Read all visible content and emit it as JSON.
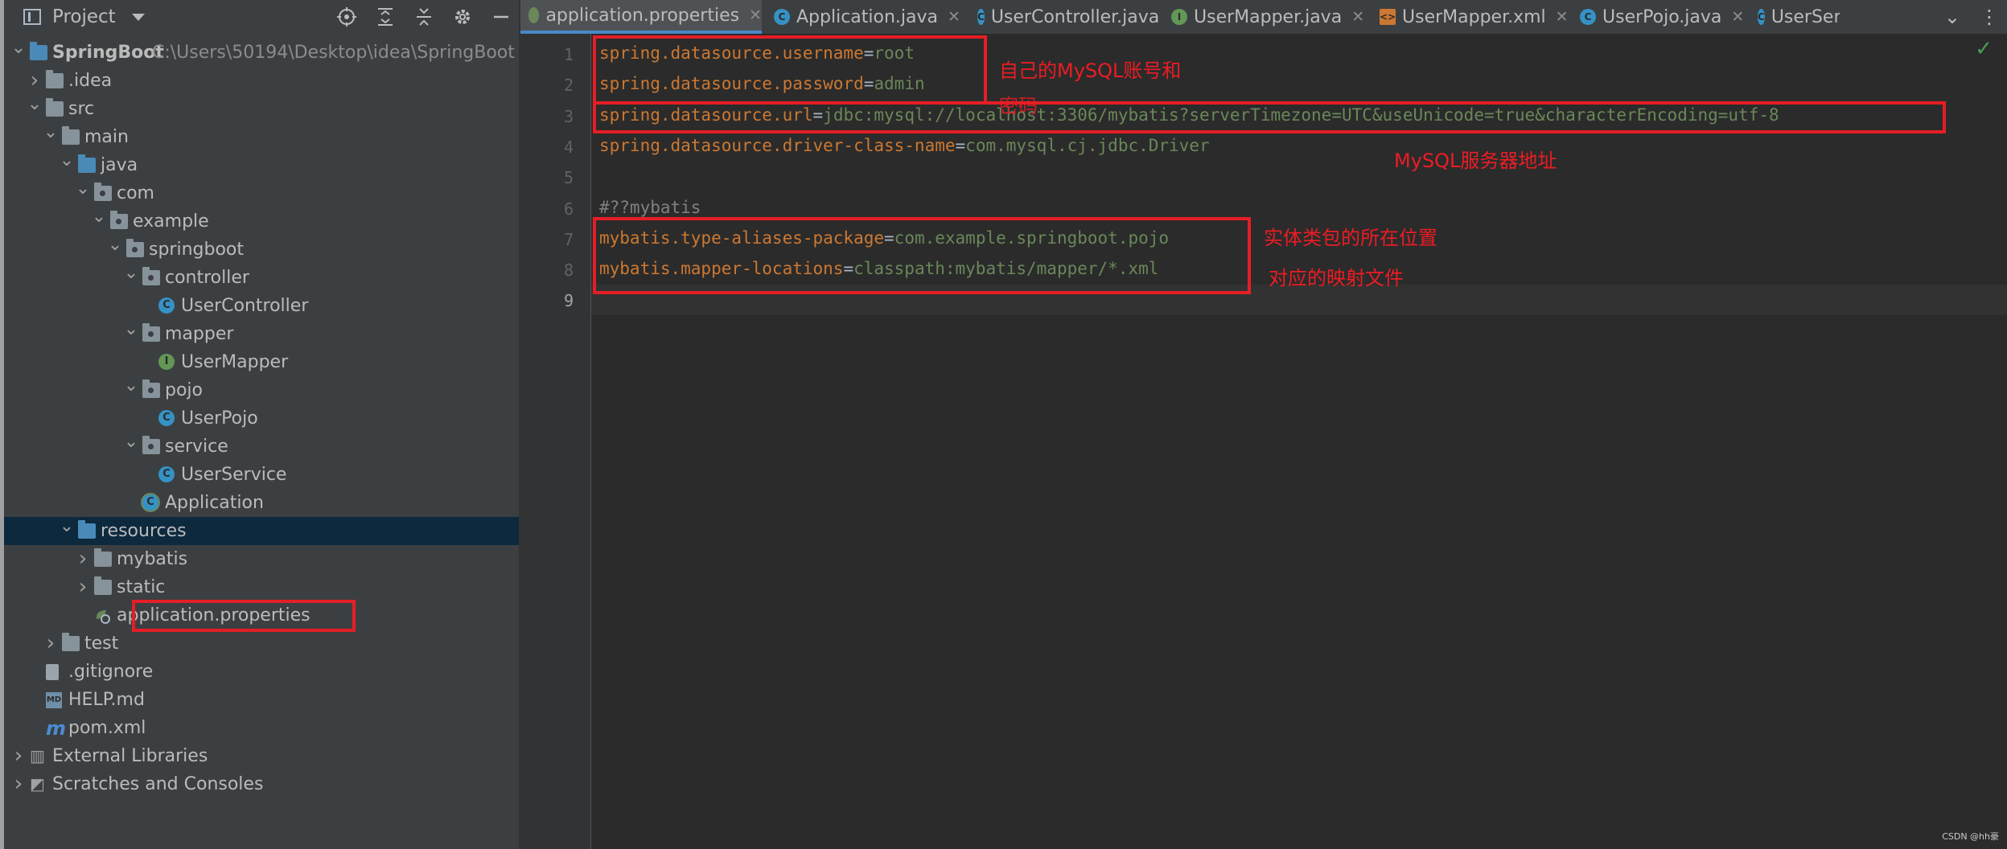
{
  "project_panel": {
    "title": "Project",
    "tree": [
      {
        "label": "SpringBoot",
        "hint": "C:\\Users\\50194\\Desktop\\idea\\SpringBoot",
        "depth": 0,
        "arrow": "down",
        "icon": "module-folder-icon",
        "bold": true
      },
      {
        "label": ".idea",
        "depth": 1,
        "arrow": "right",
        "icon": "folder-icon"
      },
      {
        "label": "src",
        "depth": 1,
        "arrow": "down",
        "icon": "folder-icon"
      },
      {
        "label": "main",
        "depth": 2,
        "arrow": "down",
        "icon": "folder-icon"
      },
      {
        "label": "java",
        "depth": 3,
        "arrow": "down",
        "icon": "source-folder-icon"
      },
      {
        "label": "com",
        "depth": 4,
        "arrow": "down",
        "icon": "package-icon"
      },
      {
        "label": "example",
        "depth": 5,
        "arrow": "down",
        "icon": "package-icon"
      },
      {
        "label": "springboot",
        "depth": 6,
        "arrow": "down",
        "icon": "package-icon"
      },
      {
        "label": "controller",
        "depth": 7,
        "arrow": "down",
        "icon": "package-icon"
      },
      {
        "label": "UserController",
        "depth": 8,
        "arrow": "",
        "icon": "class-icon"
      },
      {
        "label": "mapper",
        "depth": 7,
        "arrow": "down",
        "icon": "package-icon"
      },
      {
        "label": "UserMapper",
        "depth": 8,
        "arrow": "",
        "icon": "interface-icon"
      },
      {
        "label": "pojo",
        "depth": 7,
        "arrow": "down",
        "icon": "package-icon"
      },
      {
        "label": "UserPojo",
        "depth": 8,
        "arrow": "",
        "icon": "class-icon"
      },
      {
        "label": "service",
        "depth": 7,
        "arrow": "down",
        "icon": "package-icon"
      },
      {
        "label": "UserService",
        "depth": 8,
        "arrow": "",
        "icon": "class-icon"
      },
      {
        "label": "Application",
        "depth": 7,
        "arrow": "",
        "icon": "spring-boot-class-icon"
      },
      {
        "label": "resources",
        "depth": 3,
        "arrow": "down",
        "icon": "resources-folder-icon",
        "selected": true
      },
      {
        "label": "mybatis",
        "depth": 4,
        "arrow": "right",
        "icon": "folder-icon"
      },
      {
        "label": "static",
        "depth": 4,
        "arrow": "right",
        "icon": "folder-icon"
      },
      {
        "label": "application.properties",
        "depth": 4,
        "arrow": "",
        "icon": "properties-file-icon",
        "boxed": true
      },
      {
        "label": "test",
        "depth": 2,
        "arrow": "right",
        "icon": "folder-icon"
      },
      {
        "label": ".gitignore",
        "depth": 1,
        "arrow": "",
        "icon": "gitignore-file-icon"
      },
      {
        "label": "HELP.md",
        "depth": 1,
        "arrow": "",
        "icon": "markdown-file-icon"
      },
      {
        "label": "pom.xml",
        "depth": 1,
        "arrow": "",
        "icon": "maven-file-icon"
      },
      {
        "label": "External Libraries",
        "depth": 0,
        "arrow": "right",
        "icon": "libraries-icon"
      },
      {
        "label": "Scratches and Consoles",
        "depth": 0,
        "arrow": "right",
        "icon": "scratches-icon"
      }
    ]
  },
  "tabs": [
    {
      "label": "application.properties",
      "icon": "properties-file-icon",
      "active": true,
      "closable": true
    },
    {
      "label": "Application.java",
      "icon": "spring-boot-class-icon",
      "closable": true
    },
    {
      "label": "UserController.java",
      "icon": "class-icon",
      "closable": true
    },
    {
      "label": "UserMapper.java",
      "icon": "interface-icon",
      "closable": true
    },
    {
      "label": "UserMapper.xml",
      "icon": "xml-file-icon",
      "closable": true
    },
    {
      "label": "UserPojo.java",
      "icon": "class-icon",
      "closable": true
    },
    {
      "label": "UserService.",
      "icon": "class-icon",
      "closable": false
    }
  ],
  "editor": {
    "current_line": 9,
    "lines": [
      {
        "n": "1",
        "key": "spring.datasource.username",
        "eq": "=",
        "val": "root"
      },
      {
        "n": "2",
        "key": "spring.datasource.password",
        "eq": "=",
        "val": "admin"
      },
      {
        "n": "3",
        "key": "spring.datasource.url",
        "eq": "=",
        "val": "jdbc:mysql://localhost:3306/mybatis?serverTimezone=UTC&useUnicode=true&characterEncoding=utf-8"
      },
      {
        "n": "4",
        "key": "spring.datasource.driver-class-name",
        "eq": "=",
        "val": "com.mysql.cj.jdbc.Driver"
      },
      {
        "n": "5",
        "key": "",
        "eq": "",
        "val": ""
      },
      {
        "n": "6",
        "comment": "#??mybatis"
      },
      {
        "n": "7",
        "key": "mybatis.type-aliases-package",
        "eq": "=",
        "val": "com.example.springboot.pojo"
      },
      {
        "n": "8",
        "key": "mybatis.mapper-locations",
        "eq": "=",
        "val": "classpath:mybatis/mapper/*.xml"
      },
      {
        "n": "9",
        "key": "",
        "eq": "",
        "val": ""
      }
    ]
  },
  "annotations": {
    "credentials": "自己的MySQL账号和",
    "credentials_2": "密码",
    "server": "MySQL服务器地址",
    "entity": "实体类包的所在位置",
    "mapper": "对应的映射文件"
  },
  "status": {
    "inspection": "✓"
  },
  "watermark": "CSDN @hh豪",
  "colors": {
    "annotation_red": "#e51e25",
    "key_orange": "#cc7832",
    "value_green": "#6a8759",
    "selection_blue": "#0d293e",
    "active_tab_underline": "#4a88c7"
  }
}
